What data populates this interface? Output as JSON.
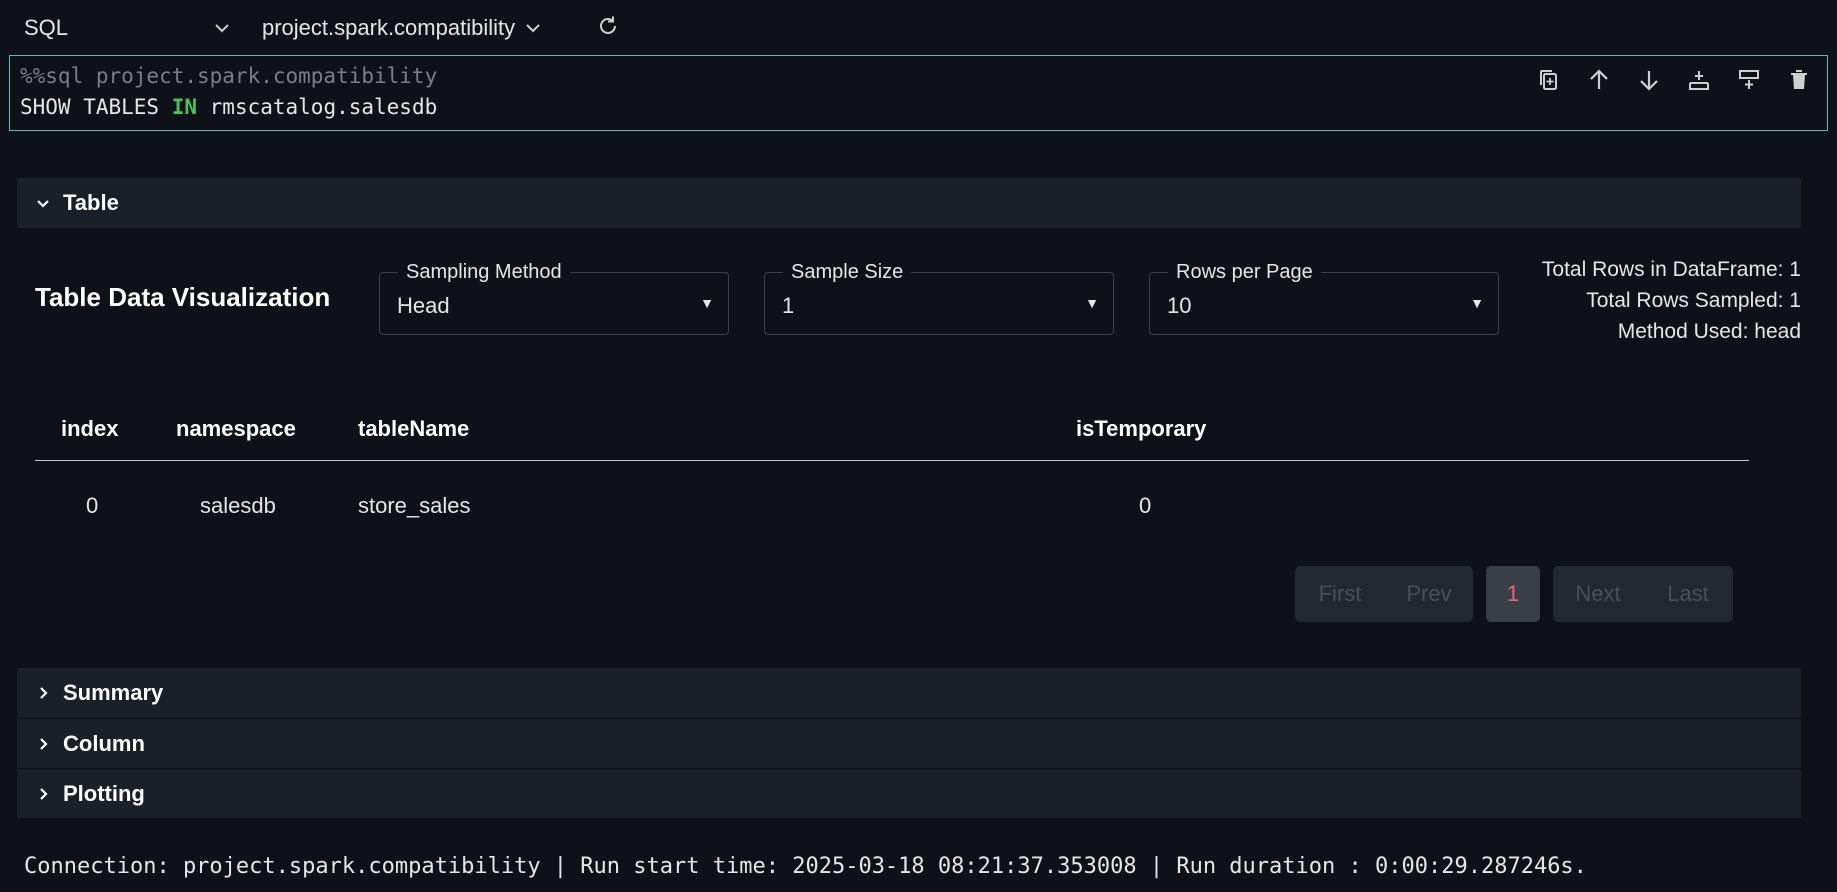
{
  "toolbar": {
    "kernel": "SQL",
    "connection": "project.spark.compatibility"
  },
  "cell": {
    "magic_line": "%%sql project.spark.compatibility",
    "code_part1": "SHOW TABLES ",
    "code_keyword": "IN",
    "code_part2": " rmscatalog.salesdb"
  },
  "panels": {
    "table": "Table",
    "summary": "Summary",
    "column": "Column",
    "plotting": "Plotting"
  },
  "viz": {
    "title": "Table Data Visualization",
    "sampling_method": {
      "label": "Sampling Method",
      "value": "Head"
    },
    "sample_size": {
      "label": "Sample Size",
      "value": "1"
    },
    "rows_per_page": {
      "label": "Rows per Page",
      "value": "10"
    },
    "stats": {
      "total_rows": "Total Rows in DataFrame: 1",
      "total_sampled": "Total Rows Sampled: 1",
      "method_used": "Method Used: head"
    }
  },
  "table": {
    "headers": [
      "index",
      "namespace",
      "tableName",
      "isTemporary"
    ],
    "rows": [
      [
        "0",
        "salesdb",
        "store_sales",
        "0"
      ]
    ]
  },
  "pager": {
    "first": "First",
    "prev": "Prev",
    "current": "1",
    "next": "Next",
    "last": "Last"
  },
  "footer": "Connection: project.spark.compatibility | Run start time: 2025-03-18 08:21:37.353008 | Run duration : 0:00:29.287246s.",
  "colors": {
    "background": "#0e1117",
    "panel": "#1a1f28",
    "cell_border": "#5bb8b2",
    "keyword": "#4cc05a",
    "current_page": "#e06c75"
  }
}
